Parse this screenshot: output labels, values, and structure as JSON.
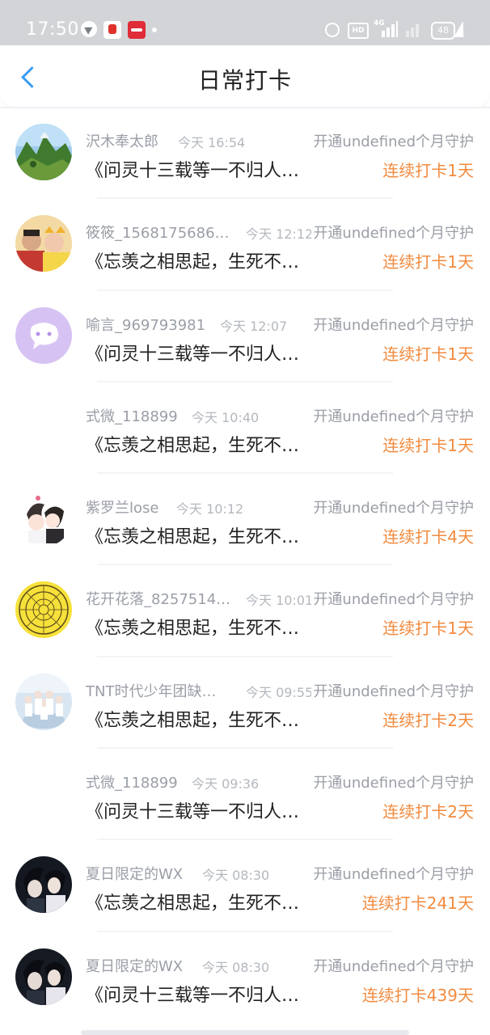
{
  "status_bar": {
    "time": "17:50",
    "hd_label": "HD",
    "signal_label": "4G",
    "battery": "48"
  },
  "header": {
    "title": "日常打卡"
  },
  "items": [
    {
      "name": "沢木奉太郎",
      "time": "今天 16:54",
      "guard": "开通undefined个月守护",
      "content": "《问灵十三载等一不归人…",
      "streak": "连续打卡1天"
    },
    {
      "name": "筱筱_1568175686…",
      "time": "今天 12:12",
      "guard": "开通undefined个月守护",
      "content": "《忘羡之相思起，生死不…",
      "streak": "连续打卡1天"
    },
    {
      "name": "喻言_969793981",
      "time": "今天 12:07",
      "guard": "开通undefined个月守护",
      "content": "《问灵十三载等一不归人…",
      "streak": "连续打卡1天"
    },
    {
      "name": "式微_118899",
      "time": "今天 10:40",
      "guard": "开通undefined个月守护",
      "content": "《忘羡之相思起，生死不…",
      "streak": "连续打卡1天"
    },
    {
      "name": "紫罗兰lose",
      "time": "今天 10:12",
      "guard": "开通undefined个月守护",
      "content": "《忘羡之相思起，生死不…",
      "streak": "连续打卡4天"
    },
    {
      "name": "花开花落_8257514…",
      "time": "今天 10:01",
      "guard": "开通undefined个月守护",
      "content": "《忘羡之相思起，生死不…",
      "streak": "连续打卡1天"
    },
    {
      "name": "TNT时代少年团缺…",
      "time": "今天 09:55",
      "guard": "开通undefined个月守护",
      "content": "《忘羡之相思起，生死不…",
      "streak": "连续打卡2天"
    },
    {
      "name": "式微_118899",
      "time": "今天 09:36",
      "guard": "开通undefined个月守护",
      "content": "《问灵十三载等一不归人…",
      "streak": "连续打卡2天"
    },
    {
      "name": "夏日限定的WX",
      "time": "今天 08:30",
      "guard": "开通undefined个月守护",
      "content": "《忘羡之相思起，生死不…",
      "streak": "连续打卡241天"
    },
    {
      "name": "夏日限定的WX",
      "time": "今天 08:30",
      "guard": "开通undefined个月守护",
      "content": "《问灵十三载等一不归人…",
      "streak": "连续打卡439天"
    }
  ],
  "colors": {
    "accent_blue": "#3a9cf3",
    "streak_orange": "#f28b3f",
    "muted_gray": "#9a9ea6",
    "status_bar_bg": "#d2d4d7"
  }
}
